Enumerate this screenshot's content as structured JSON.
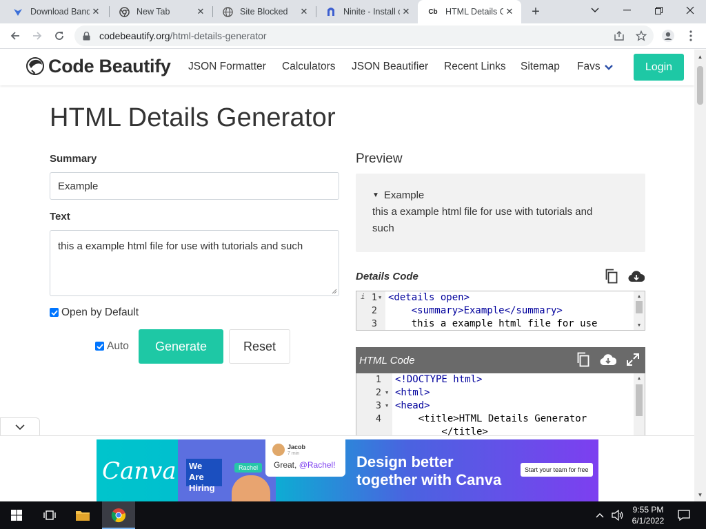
{
  "browser": {
    "tabs": [
      {
        "title": "Download Band",
        "favicon": "bandicam-icon"
      },
      {
        "title": "New Tab",
        "favicon": "chrome-icon"
      },
      {
        "title": "Site Blocked",
        "favicon": "globe-icon"
      },
      {
        "title": "Ninite - Install o",
        "favicon": "ninite-icon"
      },
      {
        "title": "HTML Details Ge",
        "favicon": "codebeautify-icon",
        "favicon_text": "Cb",
        "active": true
      }
    ],
    "address": {
      "domain": "codebeautify.org",
      "path": "/html-details-generator"
    }
  },
  "site": {
    "brand": "Code Beautify",
    "nav": [
      "JSON Formatter",
      "Calculators",
      "JSON Beautifier",
      "Recent Links",
      "Sitemap",
      "Favs"
    ],
    "login": "Login"
  },
  "form": {
    "title": "HTML Details Generator",
    "summary_label": "Summary",
    "summary_value": "Example",
    "text_label": "Text",
    "text_value": "this a example html file for use with tutorials and such",
    "open_default_label": "Open by Default",
    "open_default_checked": true,
    "auto_label": "Auto",
    "auto_checked": true,
    "generate": "Generate",
    "reset": "Reset"
  },
  "preview": {
    "heading": "Preview",
    "summary": "Example",
    "text_line1": "this a example html file for use with tutorials and",
    "text_line2": "such"
  },
  "details_code": {
    "heading": "Details Code",
    "lines": [
      {
        "n": "1",
        "pre": "",
        "code": "<details open>"
      },
      {
        "n": "2",
        "pre": "    ",
        "code": "<summary>Example</summary>"
      },
      {
        "n": "3",
        "pre": "    ",
        "code": "this a example html file for use"
      }
    ]
  },
  "html_code": {
    "heading": "HTML Code",
    "lines": [
      {
        "n": "1",
        "code": "<!DOCTYPE html>"
      },
      {
        "n": "2",
        "code": "<html>"
      },
      {
        "n": "3",
        "code": "<head>"
      },
      {
        "n": "4",
        "code": "    <title>HTML Details Generator"
      },
      {
        "n": "",
        "code": "        </title>"
      }
    ]
  },
  "ad": {
    "brand": "Canva",
    "hiring": "We Are Hiring",
    "name_tag": "Rachel",
    "chat_name": "Jacob",
    "chat_time": "7 min",
    "chat_msg": "Great, ",
    "chat_mention": "@Rachel!",
    "headline_1": "Design better",
    "headline_2": "together with Canva",
    "cta": "Start your team for free"
  },
  "taskbar": {
    "time": "9:55 PM",
    "date": "6/1/2022"
  },
  "colors": {
    "accent": "#1ec8a5",
    "checkbox": "#0075ff",
    "code_tag": "#00009c"
  }
}
